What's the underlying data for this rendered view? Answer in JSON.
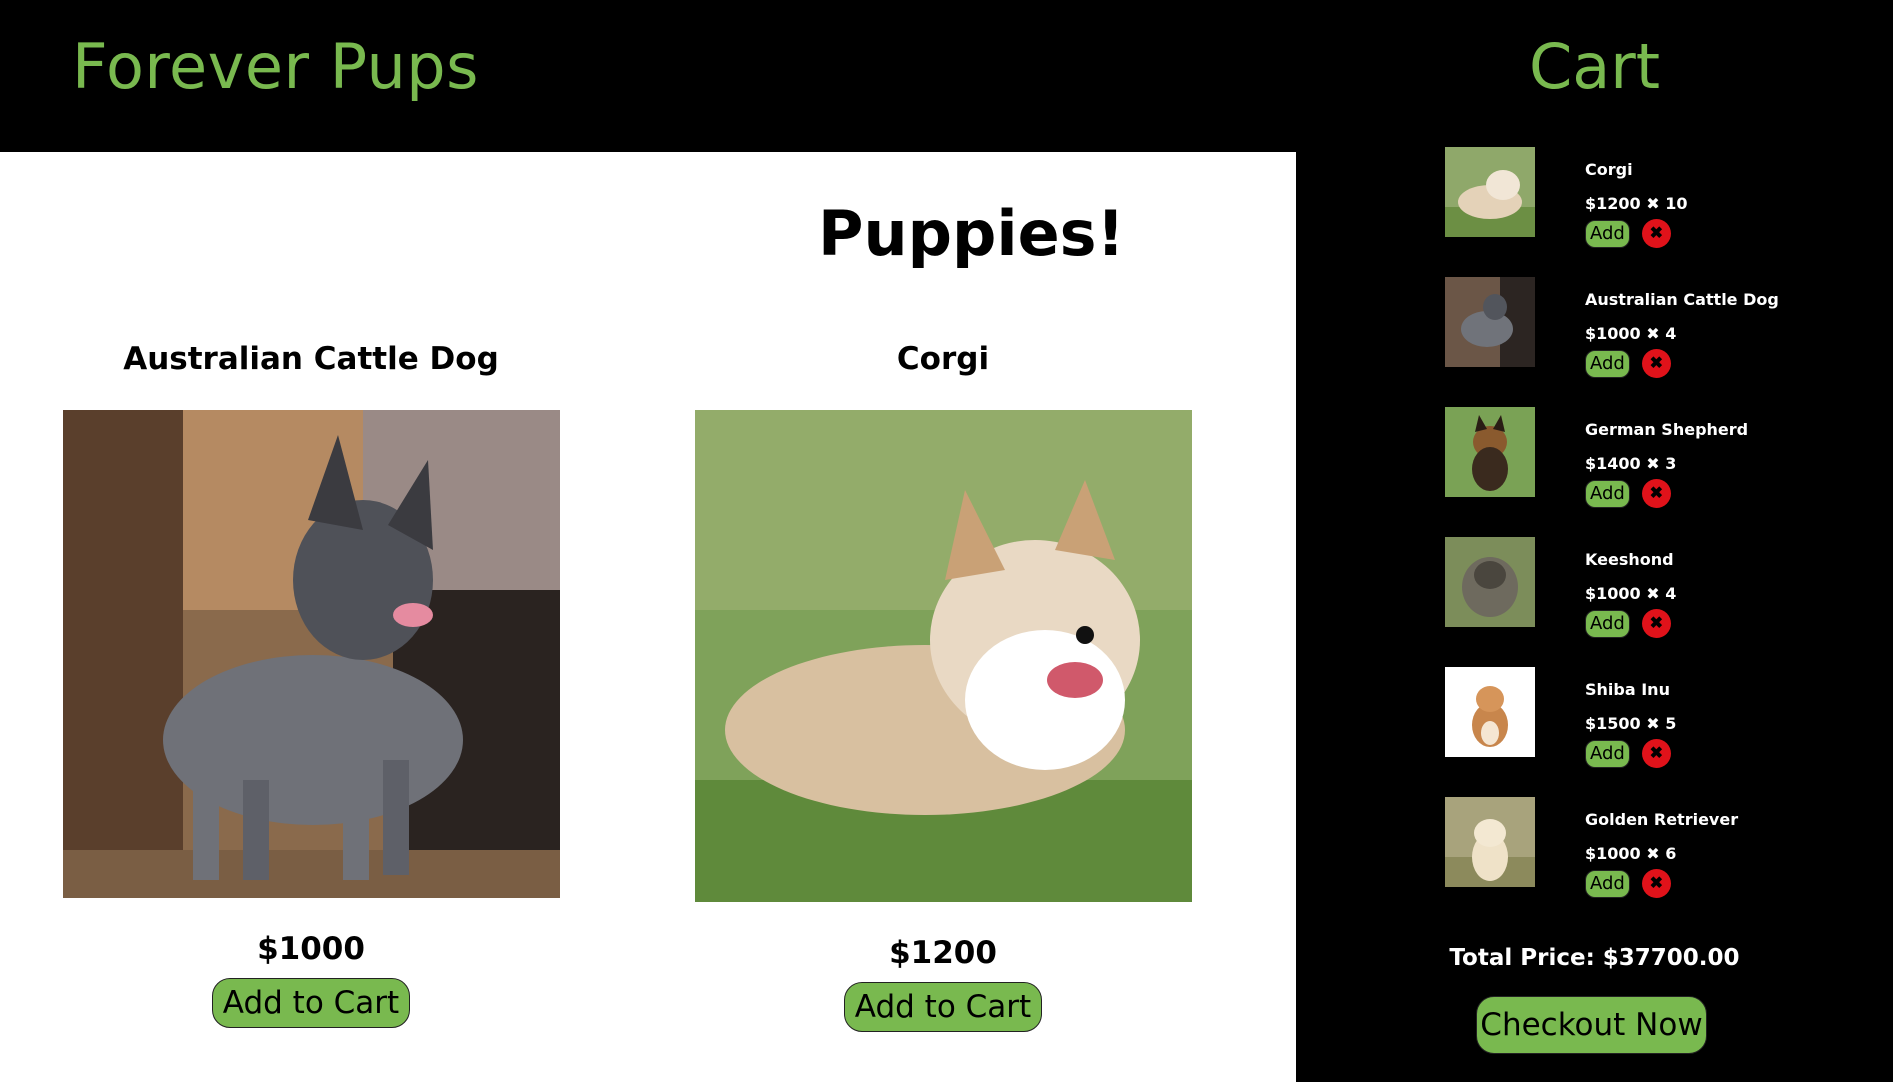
{
  "header": {
    "brand": "Forever Pups"
  },
  "main": {
    "title": "Puppies!",
    "products": [
      {
        "name": "Australian Cattle Dog",
        "price": "$1000",
        "button": "Add to Cart"
      },
      {
        "name": "Corgi",
        "price": "$1200",
        "button": "Add to Cart"
      }
    ]
  },
  "cart": {
    "title": "Cart",
    "items": [
      {
        "name": "Corgi",
        "price": "$1200",
        "qty": "10",
        "add_label": "Add",
        "remove_icon": "close-icon"
      },
      {
        "name": "Australian Cattle Dog",
        "price": "$1000",
        "qty": "4",
        "add_label": "Add",
        "remove_icon": "close-icon"
      },
      {
        "name": "German Shepherd",
        "price": "$1400",
        "qty": "3",
        "add_label": "Add",
        "remove_icon": "close-icon"
      },
      {
        "name": "Keeshond",
        "price": "$1000",
        "qty": "4",
        "add_label": "Add",
        "remove_icon": "close-icon"
      },
      {
        "name": "Shiba Inu",
        "price": "$1500",
        "qty": "5",
        "add_label": "Add",
        "remove_icon": "close-icon"
      },
      {
        "name": "Golden Retriever",
        "price": "$1000",
        "qty": "6",
        "add_label": "Add",
        "remove_icon": "close-icon"
      }
    ],
    "multiply_symbol": "✖",
    "remove_symbol": "✖",
    "total_label": "Total Price: $37700.00",
    "checkout_label": "Checkout Now"
  },
  "colors": {
    "accent": "#79b94f",
    "remove": "#e0121a",
    "background": "#000000",
    "panel": "#ffffff"
  }
}
